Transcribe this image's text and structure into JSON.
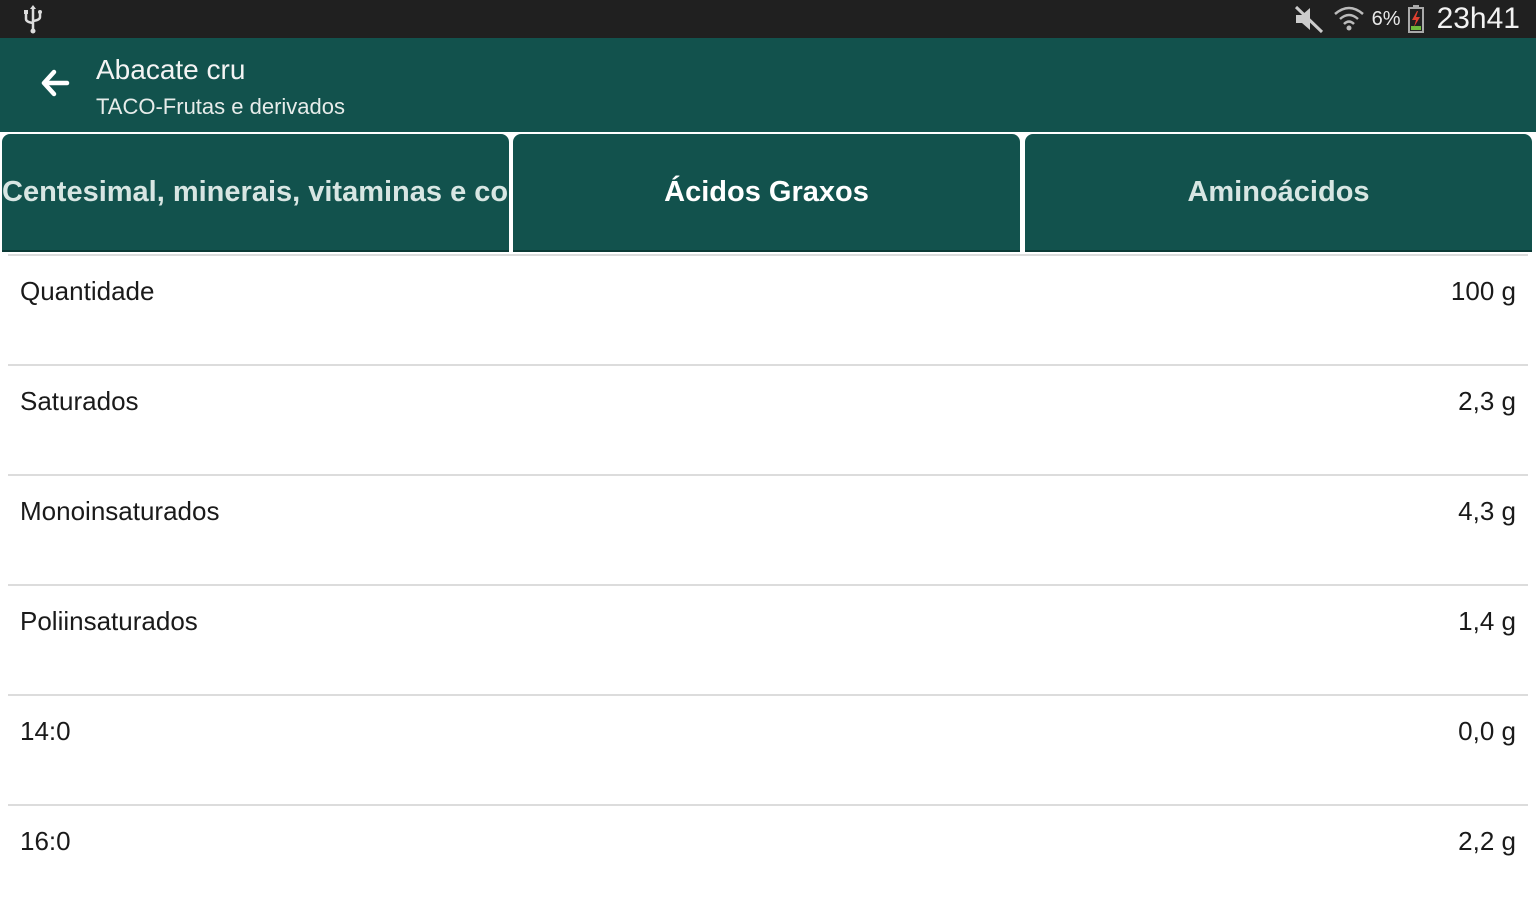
{
  "status_bar": {
    "battery_percent": "6%",
    "time": "23h41",
    "icons": [
      "usb-icon",
      "mute-icon",
      "wifi-icon",
      "battery-icon"
    ]
  },
  "app_bar": {
    "title": "Abacate cru",
    "subtitle": "TACO-Frutas e derivados",
    "back_icon": "arrow-left-icon",
    "color": "#12524d"
  },
  "tabs": [
    {
      "label": "Centesimal, minerais, vitaminas e cole",
      "active": false
    },
    {
      "label": "Ácidos Graxos",
      "active": true
    },
    {
      "label": "Aminoácidos",
      "active": false
    }
  ],
  "rows": [
    {
      "label": "Quantidade",
      "value": "100 g"
    },
    {
      "label": "Saturados",
      "value": "2,3 g"
    },
    {
      "label": "Monoinsaturados",
      "value": "4,3 g"
    },
    {
      "label": "Poliinsaturados",
      "value": "1,4 g"
    },
    {
      "label": "14:0",
      "value": "0,0 g"
    },
    {
      "label": "16:0",
      "value": "2,2 g"
    }
  ]
}
